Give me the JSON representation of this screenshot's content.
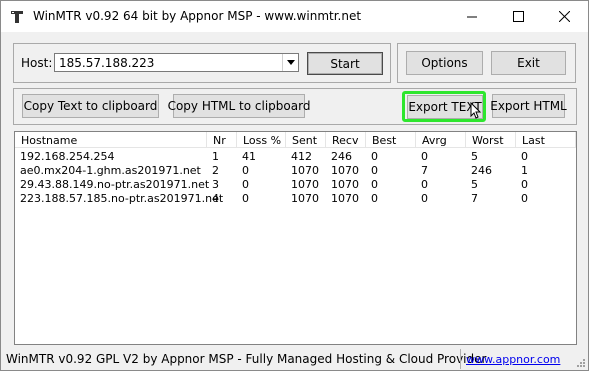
{
  "window": {
    "title": "WinMTR v0.92 64 bit by Appnor MSP - www.winmtr.net"
  },
  "host": {
    "label": "Host:",
    "value": "185.57.188.223"
  },
  "buttons": {
    "start": "Start",
    "options": "Options",
    "exit": "Exit",
    "copy_text": "Copy Text to clipboard",
    "copy_html": "Copy HTML to clipboard",
    "export_text": "Export TEXT",
    "export_html": "Export HTML"
  },
  "table": {
    "columns": [
      "Hostname",
      "Nr",
      "Loss %",
      "Sent",
      "Recv",
      "Best",
      "Avrg",
      "Worst",
      "Last"
    ],
    "rows": [
      [
        "192.168.254.254",
        "1",
        "41",
        "412",
        "246",
        "0",
        "0",
        "5",
        "0"
      ],
      [
        "ae0.mx204-1.ghm.as201971.net",
        "2",
        "0",
        "1070",
        "1070",
        "0",
        "7",
        "246",
        "1"
      ],
      [
        "29.43.88.149.no-ptr.as201971.net",
        "3",
        "0",
        "1070",
        "1070",
        "0",
        "0",
        "5",
        "0"
      ],
      [
        "223.188.57.185.no-ptr.as201971.net",
        "4",
        "0",
        "1070",
        "1070",
        "0",
        "0",
        "7",
        "0"
      ]
    ]
  },
  "statusbar": {
    "text": "WinMTR v0.92 GPL V2 by Appnor MSP - Fully Managed Hosting & Cloud Provider",
    "link": "www.appnor.com"
  }
}
